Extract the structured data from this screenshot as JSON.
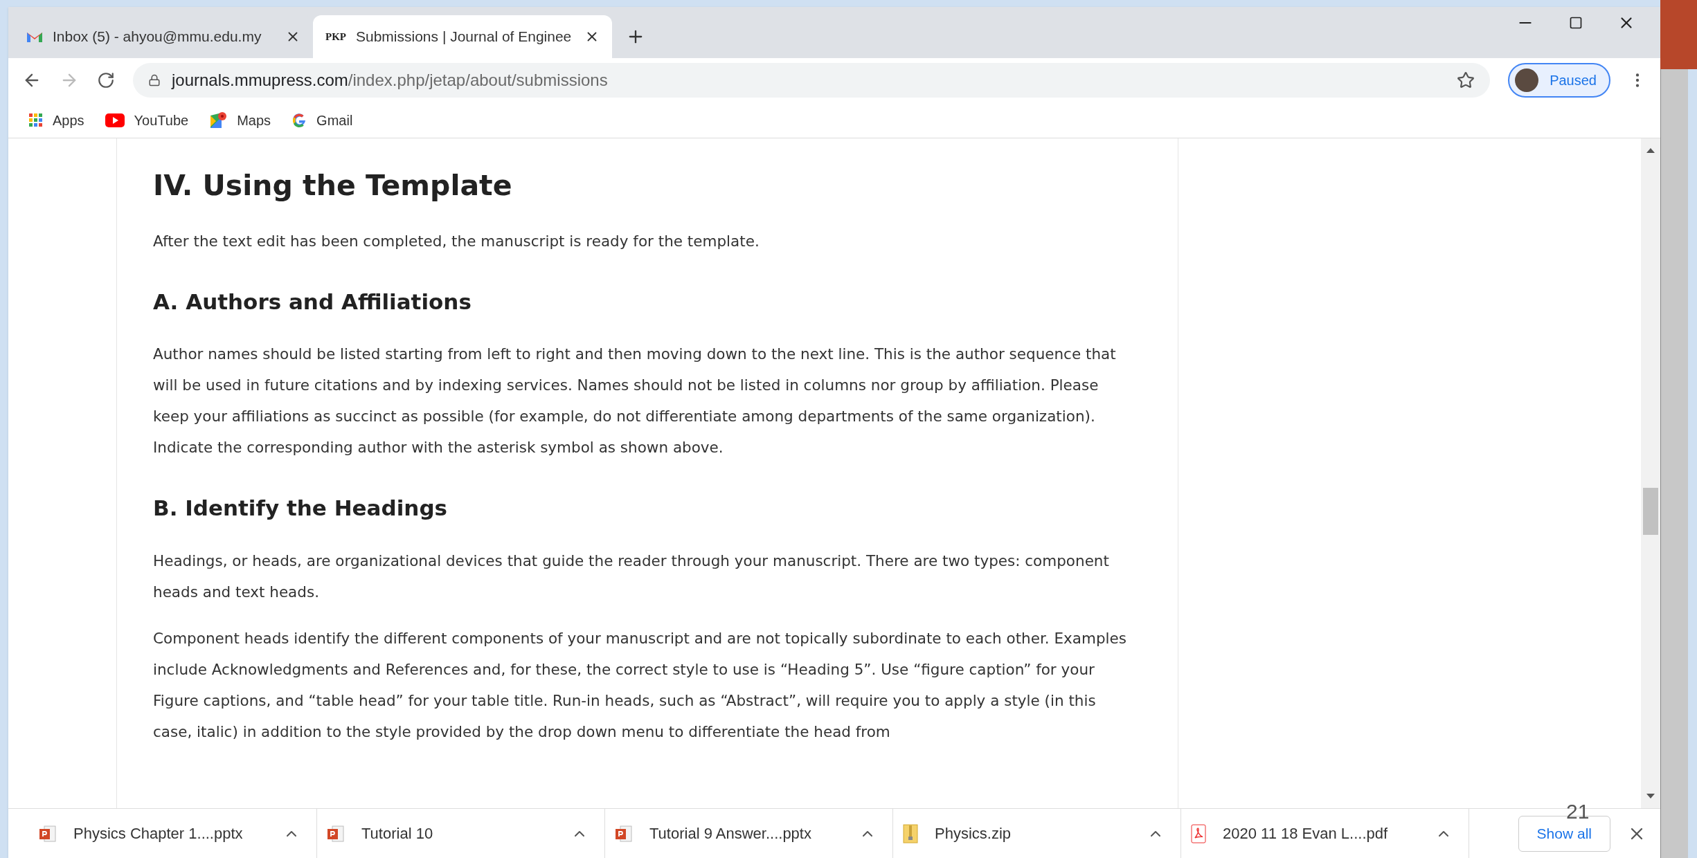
{
  "tabs": [
    {
      "title": "Inbox (5) - ahyou@mmu.edu.my",
      "kind": "gmail",
      "selected": false
    },
    {
      "title": "Submissions | Journal of Enginee",
      "kind": "text",
      "favicon_text": "PKP",
      "selected": true
    }
  ],
  "address": {
    "host": "journals.mmupress.com",
    "path": "/index.php/jetap/about/submissions"
  },
  "profile": {
    "status": "Paused"
  },
  "bookmarks": [
    {
      "label": "Apps",
      "kind": "apps"
    },
    {
      "label": "YouTube",
      "kind": "youtube"
    },
    {
      "label": "Maps",
      "kind": "maps"
    },
    {
      "label": "Gmail",
      "kind": "google"
    }
  ],
  "article": [
    {
      "kind": "h1",
      "text": "IV. Using the Template"
    },
    {
      "kind": "p",
      "text": "After the text edit has been completed, the manuscript is ready for the template."
    },
    {
      "kind": "h2",
      "text": "A. Authors and Affiliations"
    },
    {
      "kind": "p",
      "text": "Author names should be listed starting from left to right and then moving down to the next line. This is the author sequence that will be used in future citations and by indexing services. Names should not be listed in columns nor group by affiliation. Please keep your affiliations as succinct as possible (for example, do not differentiate among departments of the same organization). Indicate the corresponding author with the asterisk symbol as shown above."
    },
    {
      "kind": "h2",
      "text": "B. Identify the Headings"
    },
    {
      "kind": "p",
      "text": "Headings, or heads, are organizational devices that guide the reader through your manuscript. There are two types: component heads and text heads."
    },
    {
      "kind": "p",
      "text": "Component heads identify the different components of your manuscript and are not topically subordinate to each other. Examples include Acknowledgments and References and, for these, the correct style to use is “Heading 5”. Use “figure caption” for your Figure captions, and “table head” for your table title. Run-in heads, such as “Abstract”, will require you to apply a style (in this case, italic) in addition to the style provided by the drop down menu to differentiate the head from"
    }
  ],
  "downloads": [
    {
      "name": "Physics Chapter 1....pptx",
      "kind": "pptx"
    },
    {
      "name": "Tutorial 10",
      "kind": "pptx"
    },
    {
      "name": "Tutorial 9 Answer....pptx",
      "kind": "pptx"
    },
    {
      "name": "Physics.zip",
      "kind": "zip"
    },
    {
      "name": "2020 11 18 Evan L....pdf",
      "kind": "pdf"
    }
  ],
  "show_all": "Show all",
  "slide_number": "21"
}
